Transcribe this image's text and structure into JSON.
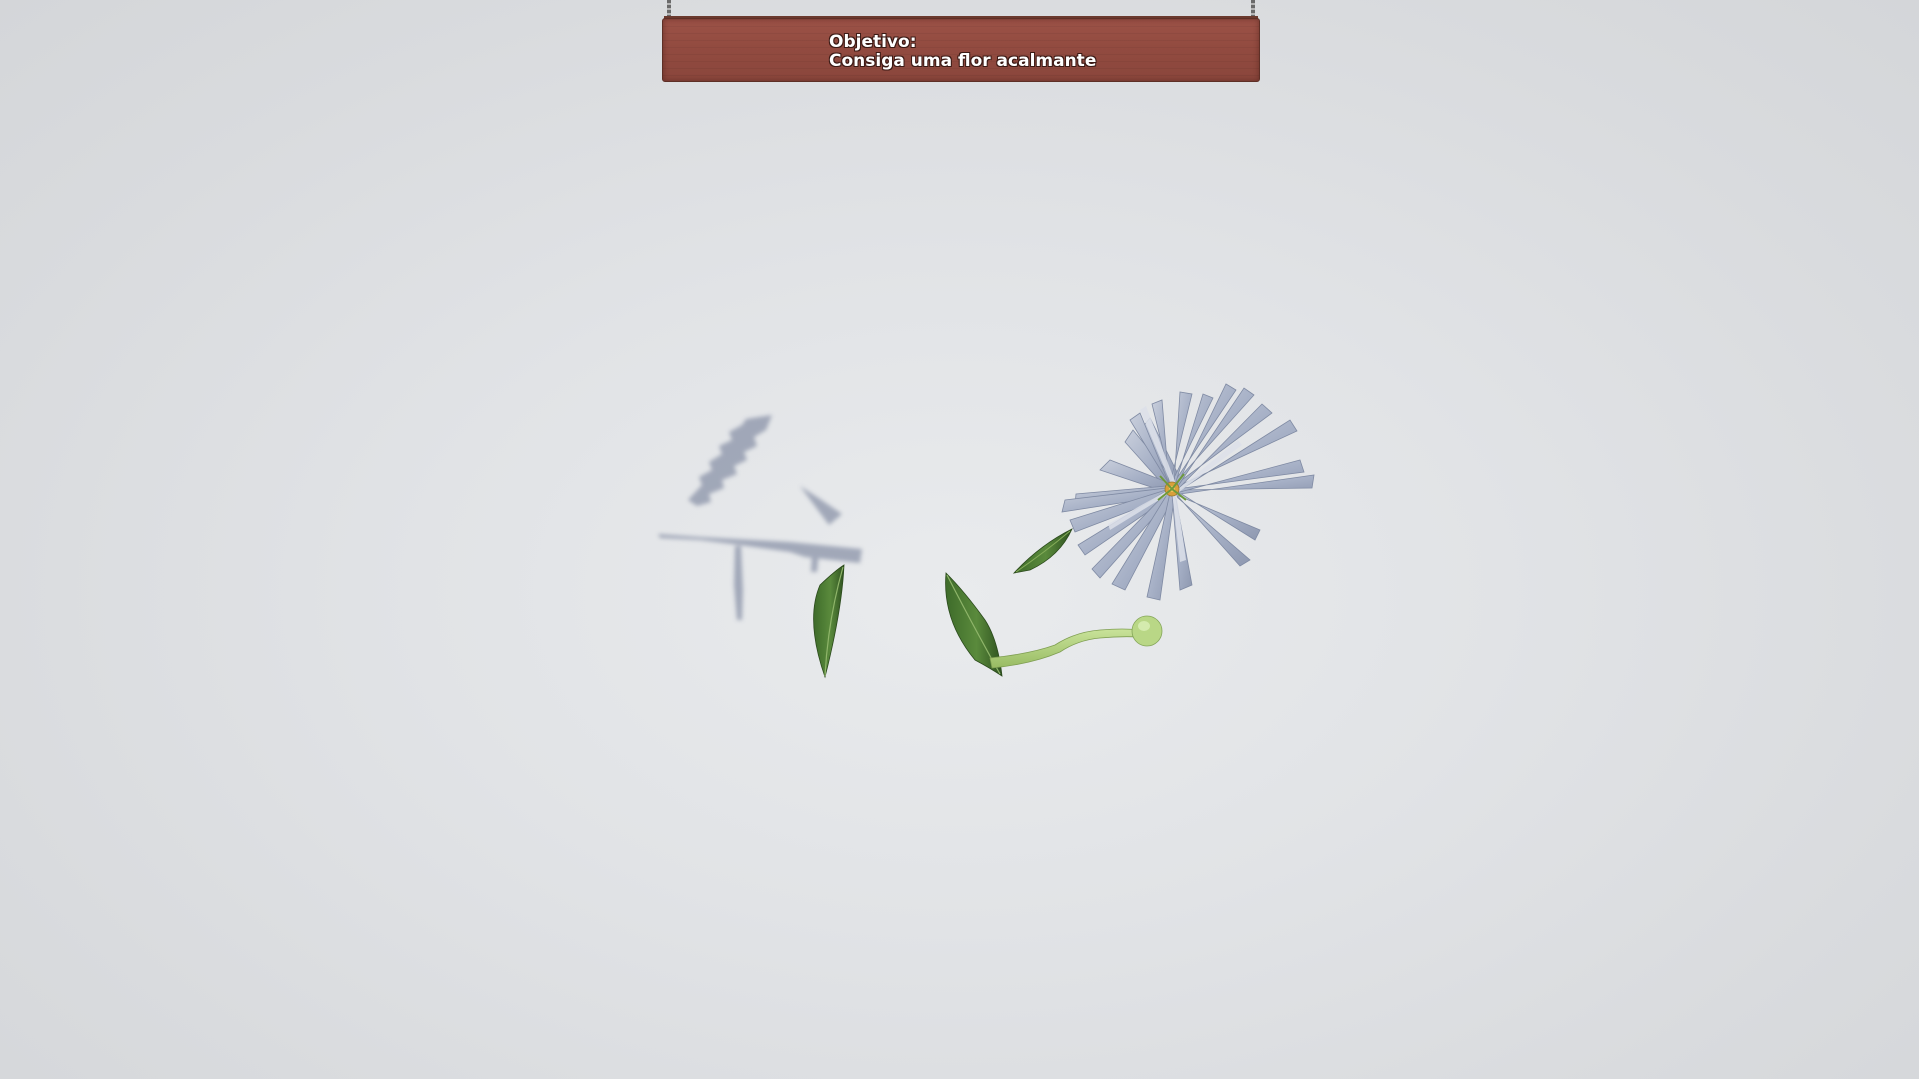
{
  "objective": {
    "heading": "Objetivo:",
    "text": "Consiga uma flor acalmante"
  },
  "scene": {
    "background_color": "#dfe1e4",
    "petal_color": "#a9b3c9",
    "leaf_color": "#4f7a34",
    "stem_color": "#b3d27c",
    "flower_center_color": "#e0a32a",
    "sign_color": "#934c41",
    "objects": [
      "flower-head",
      "leaf",
      "leaf",
      "leaf",
      "stem",
      "shadow"
    ]
  }
}
